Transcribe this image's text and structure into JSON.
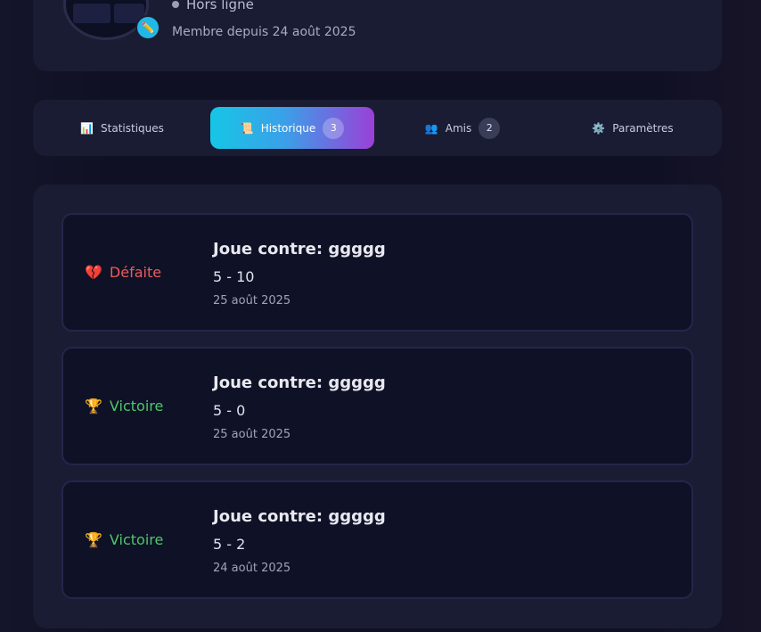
{
  "profile": {
    "status": "Hors ligne",
    "member_since": "Membre depuis 24 août 2025",
    "edit_icon": "pencil-icon"
  },
  "tabs": [
    {
      "label": "Statistiques",
      "icon": "bar-chart-icon",
      "count": null,
      "active": false
    },
    {
      "label": "Historique",
      "icon": "scroll-icon",
      "count": "3",
      "active": true
    },
    {
      "label": "Amis",
      "icon": "people-icon",
      "count": "2",
      "active": false
    },
    {
      "label": "Paramètres",
      "icon": "gear-icon",
      "count": null,
      "active": false
    }
  ],
  "history": [
    {
      "result": "Défaite",
      "type": "loss",
      "icon": "broken-heart-icon",
      "opponent": "Joue contre: ggggg",
      "score": "5 - 10",
      "date": "25 août 2025"
    },
    {
      "result": "Victoire",
      "type": "win",
      "icon": "trophy-icon",
      "opponent": "Joue contre: ggggg",
      "score": "5 - 0",
      "date": "25 août 2025"
    },
    {
      "result": "Victoire",
      "type": "win",
      "icon": "trophy-icon",
      "opponent": "Joue contre: ggggg",
      "score": "5 - 2",
      "date": "24 août 2025"
    }
  ],
  "colors": {
    "accent_start": "#16c6e6",
    "accent_end": "#9a40d8",
    "loss": "#ef5a5a",
    "win": "#4cc86a"
  }
}
